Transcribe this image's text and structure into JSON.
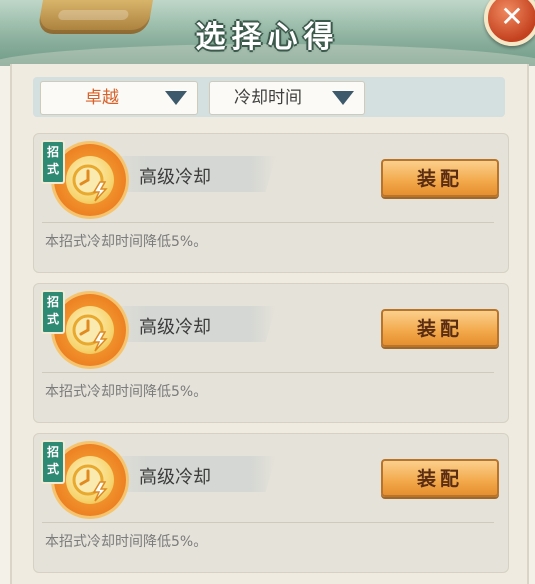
{
  "header": {
    "title": "选择心得",
    "close_icon": "close-icon"
  },
  "filters": {
    "quality": "卓越",
    "effect": "冷却时间"
  },
  "cards": [
    {
      "type_badge": "招式",
      "icon": "clock-cooldown-icon",
      "name": "高级冷却",
      "equip_label": "装配",
      "description": "本招式冷却时间降低5%。"
    },
    {
      "type_badge": "招式",
      "icon": "clock-cooldown-icon",
      "name": "高级冷却",
      "equip_label": "装配",
      "description": "本招式冷却时间降低5%。"
    },
    {
      "type_badge": "招式",
      "icon": "clock-cooldown-icon",
      "name": "高级冷却",
      "equip_label": "装配",
      "description": "本招式冷却时间降低5%。"
    }
  ],
  "colors": {
    "accent": "#ee8424",
    "badge": "#2f8a73",
    "header": "#8fb3a0"
  }
}
